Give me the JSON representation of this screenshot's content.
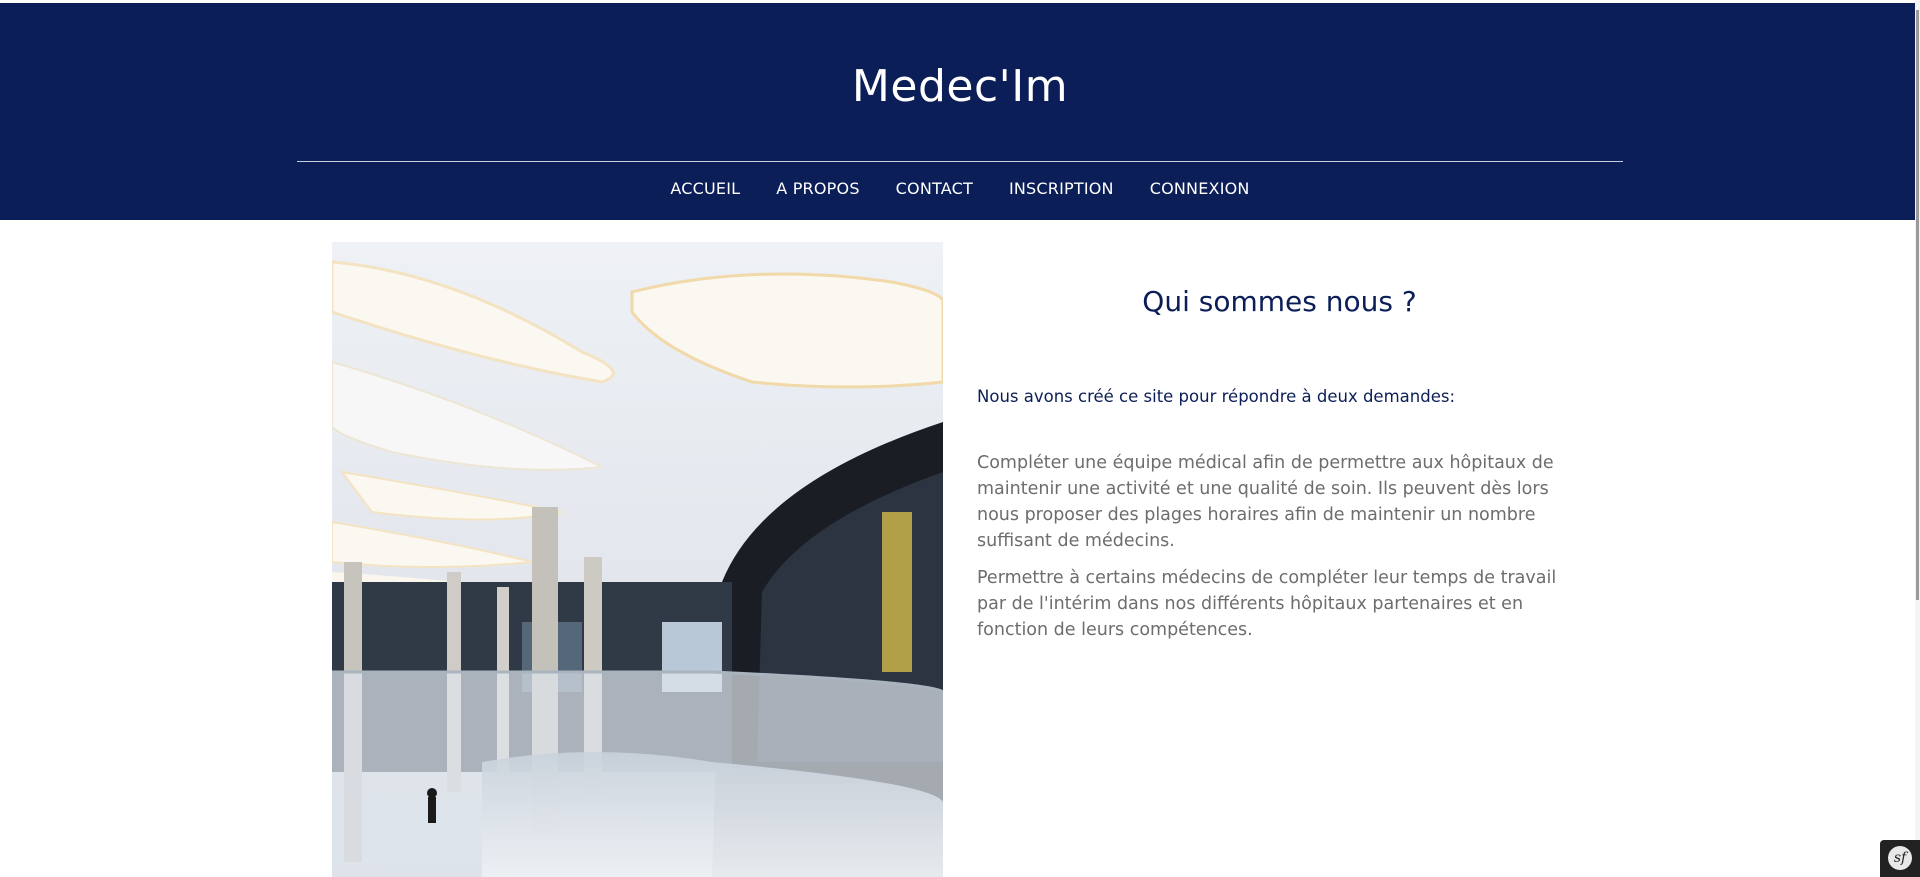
{
  "brand": {
    "title": "Medec'Im"
  },
  "nav": {
    "items": [
      {
        "label": "ACCUEIL"
      },
      {
        "label": "A PROPOS"
      },
      {
        "label": "CONTACT"
      },
      {
        "label": "INSCRIPTION"
      },
      {
        "label": "CONNEXION"
      }
    ]
  },
  "about": {
    "heading": "Qui sommes nous ?",
    "intro": "Nous avons créé ce site pour répondre à deux demandes:",
    "paragraphs": [
      "Compléter une équipe médical afin de permettre aux hôpitaux de maintenir une activité et une qualité de soin. Ils peuvent dès lors nous proposer des plages horaires afin de maintenir un nombre suffisant de médecins.",
      "Permettre à certains médecins de compléter leur temps de travail par de l'intérim dans nos différents hôpitaux partenaires et en fonction de leurs compétences."
    ]
  },
  "toolbar": {
    "logo_text": "sf"
  },
  "colors": {
    "header_bg": "#0b1e57",
    "heading": "#0b1e57",
    "body_text": "#6d6d6d",
    "toolbar_bg": "#222222"
  },
  "icons": {
    "toolbar": "symfony-logo-icon"
  }
}
